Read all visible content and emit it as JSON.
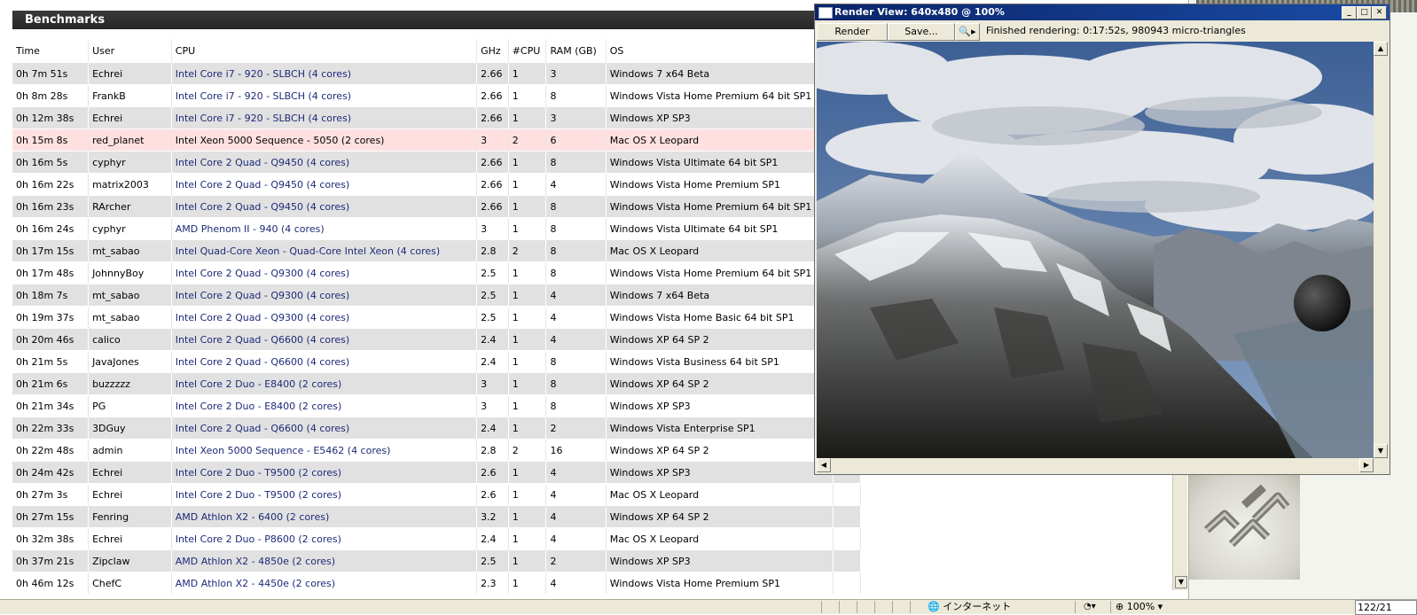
{
  "benchmarks": {
    "title": "Benchmarks",
    "columns": [
      "Time",
      "User",
      "CPU",
      "GHz",
      "#CPU",
      "RAM (GB)",
      "OS"
    ],
    "rows": [
      {
        "time": "0h 7m 51s",
        "user": "Echrei",
        "cpu": "Intel Core i7 - 920 - SLBCH (4 cores)",
        "ghz": "2.66",
        "ncpu": "1",
        "ram": "3",
        "os": "Windows 7 x64 Beta"
      },
      {
        "time": "0h 8m 28s",
        "user": "FrankB",
        "cpu": "Intel Core i7 - 920 - SLBCH (4 cores)",
        "ghz": "2.66",
        "ncpu": "1",
        "ram": "8",
        "os": "Windows Vista Home Premium 64 bit SP1"
      },
      {
        "time": "0h 12m 38s",
        "user": "Echrei",
        "cpu": "Intel Core i7 - 920 - SLBCH (4 cores)",
        "ghz": "2.66",
        "ncpu": "1",
        "ram": "3",
        "os": "Windows XP SP3"
      },
      {
        "time": "0h 15m 8s",
        "user": "red_planet",
        "cpu": "Intel Xeon 5000 Sequence - 5050 (2 cores)",
        "ghz": "3",
        "ncpu": "2",
        "ram": "6",
        "os": "Mac OS X Leopard"
      },
      {
        "time": "0h 16m 5s",
        "user": "cyphyr",
        "cpu": "Intel Core 2 Quad - Q9450 (4 cores)",
        "ghz": "2.66",
        "ncpu": "1",
        "ram": "8",
        "os": "Windows Vista Ultimate 64 bit SP1"
      },
      {
        "time": "0h 16m 22s",
        "user": "matrix2003",
        "cpu": "Intel Core 2 Quad - Q9450 (4 cores)",
        "ghz": "2.66",
        "ncpu": "1",
        "ram": "4",
        "os": "Windows Vista Home Premium SP1"
      },
      {
        "time": "0h 16m 23s",
        "user": "RArcher",
        "cpu": "Intel Core 2 Quad - Q9450 (4 cores)",
        "ghz": "2.66",
        "ncpu": "1",
        "ram": "8",
        "os": "Windows Vista Home Premium 64 bit SP1"
      },
      {
        "time": "0h 16m 24s",
        "user": "cyphyr",
        "cpu": "AMD Phenom II - 940 (4 cores)",
        "ghz": "3",
        "ncpu": "1",
        "ram": "8",
        "os": "Windows Vista Ultimate 64 bit SP1"
      },
      {
        "time": "0h 17m 15s",
        "user": "mt_sabao",
        "cpu": "Intel Quad-Core Xeon - Quad-Core Intel Xeon (4 cores)",
        "ghz": "2.8",
        "ncpu": "2",
        "ram": "8",
        "os": "Mac OS X Leopard"
      },
      {
        "time": "0h 17m 48s",
        "user": "JohnnyBoy",
        "cpu": "Intel Core 2 Quad - Q9300 (4 cores)",
        "ghz": "2.5",
        "ncpu": "1",
        "ram": "8",
        "os": "Windows Vista Home Premium 64 bit SP1"
      },
      {
        "time": "0h 18m 7s",
        "user": "mt_sabao",
        "cpu": "Intel Core 2 Quad - Q9300 (4 cores)",
        "ghz": "2.5",
        "ncpu": "1",
        "ram": "4",
        "os": "Windows 7 x64 Beta"
      },
      {
        "time": "0h 19m 37s",
        "user": "mt_sabao",
        "cpu": "Intel Core 2 Quad - Q9300 (4 cores)",
        "ghz": "2.5",
        "ncpu": "1",
        "ram": "4",
        "os": "Windows Vista Home Basic 64 bit SP1"
      },
      {
        "time": "0h 20m 46s",
        "user": "calico",
        "cpu": "Intel Core 2 Quad - Q6600 (4 cores)",
        "ghz": "2.4",
        "ncpu": "1",
        "ram": "4",
        "os": "Windows XP 64 SP 2"
      },
      {
        "time": "0h 21m 5s",
        "user": "JavaJones",
        "cpu": "Intel Core 2 Quad - Q6600 (4 cores)",
        "ghz": "2.4",
        "ncpu": "1",
        "ram": "8",
        "os": "Windows Vista Business 64 bit SP1"
      },
      {
        "time": "0h 21m 6s",
        "user": "buzzzzz",
        "cpu": "Intel Core 2 Duo - E8400 (2 cores)",
        "ghz": "3",
        "ncpu": "1",
        "ram": "8",
        "os": "Windows XP 64 SP 2"
      },
      {
        "time": "0h 21m 34s",
        "user": "PG",
        "cpu": "Intel Core 2 Duo - E8400 (2 cores)",
        "ghz": "3",
        "ncpu": "1",
        "ram": "8",
        "os": "Windows XP SP3"
      },
      {
        "time": "0h 22m 33s",
        "user": "3DGuy",
        "cpu": "Intel Core 2 Quad - Q6600 (4 cores)",
        "ghz": "2.4",
        "ncpu": "1",
        "ram": "2",
        "os": "Windows Vista Enterprise SP1"
      },
      {
        "time": "0h 22m 48s",
        "user": "admin",
        "cpu": "Intel Xeon 5000 Sequence - E5462 (4 cores)",
        "ghz": "2.8",
        "ncpu": "2",
        "ram": "16",
        "os": "Windows XP 64 SP 2"
      },
      {
        "time": "0h 24m 42s",
        "user": "Echrei",
        "cpu": "Intel Core 2 Duo - T9500 (2 cores)",
        "ghz": "2.6",
        "ncpu": "1",
        "ram": "4",
        "os": "Windows XP SP3"
      },
      {
        "time": "0h 27m 3s",
        "user": "Echrei",
        "cpu": "Intel Core 2 Duo - T9500 (2 cores)",
        "ghz": "2.6",
        "ncpu": "1",
        "ram": "4",
        "os": "Mac OS X Leopard"
      },
      {
        "time": "0h 27m 15s",
        "user": "Fenring",
        "cpu": "AMD Athlon X2 - 6400 (2 cores)",
        "ghz": "3.2",
        "ncpu": "1",
        "ram": "4",
        "os": "Windows XP 64 SP 2"
      },
      {
        "time": "0h 32m 38s",
        "user": "Echrei",
        "cpu": "Intel Core 2 Duo - P8600 (2 cores)",
        "ghz": "2.4",
        "ncpu": "1",
        "ram": "4",
        "os": "Mac OS X Leopard"
      },
      {
        "time": "0h 37m 21s",
        "user": "Zipclaw",
        "cpu": "AMD Athlon X2 - 4850e (2 cores)",
        "ghz": "2.5",
        "ncpu": "1",
        "ram": "2",
        "os": "Windows XP SP3"
      },
      {
        "time": "0h 46m 12s",
        "user": "ChefC",
        "cpu": "AMD Athlon X2 - 4450e (2 cores)",
        "ghz": "2.3",
        "ncpu": "1",
        "ram": "4",
        "os": "Windows Vista Home Premium SP1"
      }
    ],
    "highlight_row": 3,
    "colors": {
      "header_bg": "#2f2f2f",
      "row_alt": "#e1e1e1",
      "highlight": "#ffe0e0",
      "cpu_link": "#1e2a78"
    }
  },
  "render_view": {
    "title": "Render View: 640x480 @ 100%",
    "render_button": "Render",
    "save_button": "Save...",
    "status": "Finished rendering: 0:17:52s, 980943 micro-triangles",
    "title_color": "#0a246a"
  },
  "statusbar": {
    "zone": "インターネット",
    "zoom": "100%",
    "page": "122/21"
  }
}
